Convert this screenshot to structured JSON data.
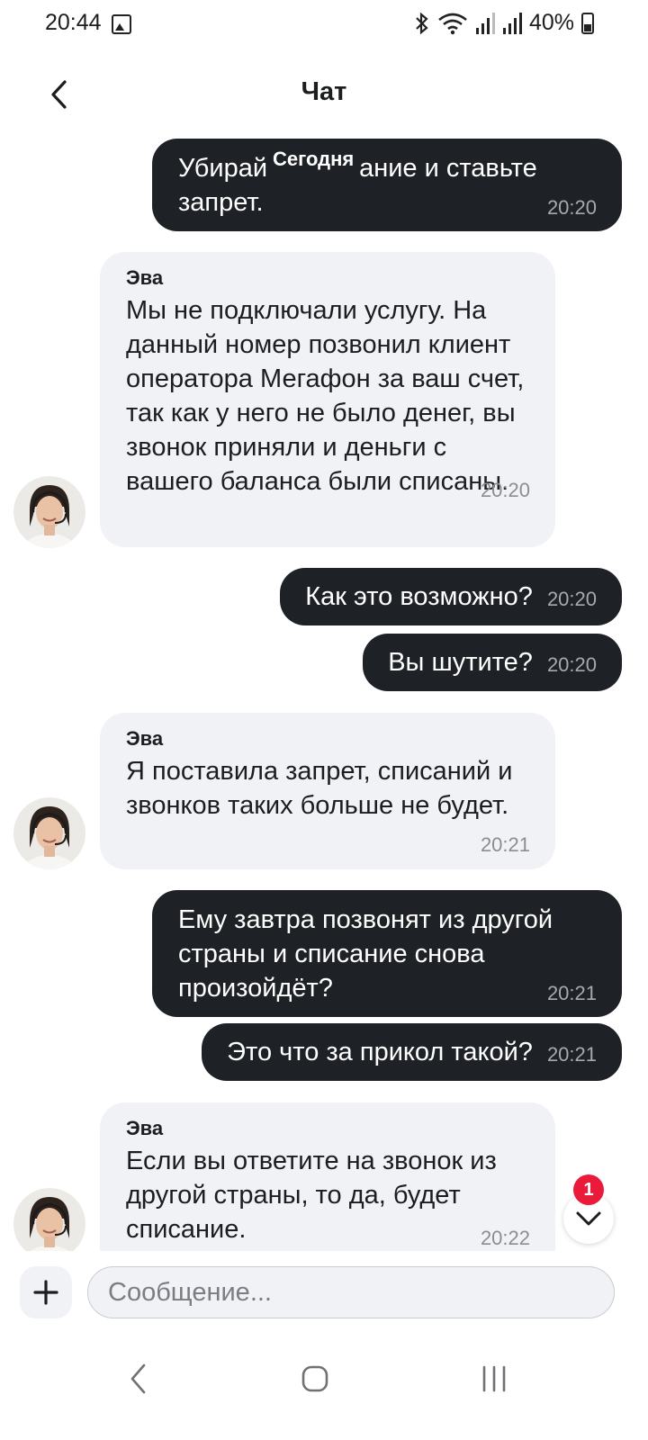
{
  "status_bar": {
    "time": "20:44",
    "battery": "40%",
    "icons": [
      "image-icon",
      "bluetooth-icon",
      "wifi-icon",
      "signal-icon",
      "signal-icon",
      "battery-icon"
    ]
  },
  "header": {
    "title": "Чат",
    "back_icon": "chevron-left-icon"
  },
  "chat": {
    "date_separator": "Сегодня",
    "messages": [
      {
        "direction": "out",
        "text": "Убирайте списание и ставьте запрет.",
        "visible_line_1": "Убирай",
        "visible_line_1b": "ание и ставьте",
        "visible_line_2": "запрет.",
        "time": "20:20"
      },
      {
        "direction": "in",
        "sender": "Эва",
        "text": "Мы не подключали услугу. На данный номер позвонил клиент оператора Мегафон за ваш счет, так как у него не было денег, вы звонок приняли и деньги с вашего баланса были списаны.",
        "time": "20:20"
      },
      {
        "direction": "out",
        "text": "Как это возможно?",
        "time": "20:20"
      },
      {
        "direction": "out",
        "text": "Вы шутите?",
        "time": "20:20"
      },
      {
        "direction": "in",
        "sender": "Эва",
        "text": "Я поставила запрет, списаний и звонков таких больше не будет.",
        "time": "20:21"
      },
      {
        "direction": "out",
        "text": "Ему завтра позвонят из другой страны и списание снова произойдёт?",
        "time": "20:21"
      },
      {
        "direction": "out",
        "text": "Это что за прикол такой?",
        "time": "20:21"
      },
      {
        "direction": "in",
        "sender": "Эва",
        "text": "Если вы ответите на звонок из другой страны, то да, будет списание.",
        "time": "20:22"
      }
    ],
    "unread_count": "1",
    "scroll_icon": "chevron-down-icon"
  },
  "input": {
    "placeholder": "Сообщение...",
    "attach_icon": "plus-icon"
  },
  "colors": {
    "outgoing_bubble": "#1e2125",
    "incoming_bubble": "#f1f2f6",
    "badge": "#ea1b3a"
  },
  "nav": {
    "icons": [
      "nav-back-icon",
      "nav-home-icon",
      "nav-recents-icon"
    ]
  }
}
